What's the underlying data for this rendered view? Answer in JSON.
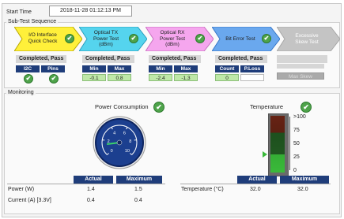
{
  "start_time": {
    "label": "Start Time",
    "value": "2018-11-28 01:12:13 PM"
  },
  "sub_test_sequence": {
    "title": "Sub-Test Sequence",
    "steps": [
      {
        "label": "I/O Interface\nQuick Check",
        "color": "#fff03a",
        "status": "Completed, Pass",
        "headers": [
          "I2C",
          "Pins"
        ]
      },
      {
        "label": "Optical TX\nPower Test\n(dBm)",
        "color": "#55d4ee",
        "status": "Completed, Pass",
        "headers": [
          "Min",
          "Max"
        ],
        "values": [
          "-0.1",
          "0.8"
        ]
      },
      {
        "label": "Optical RX\nPower Test\n(dBm)",
        "color": "#f5a6ee",
        "status": "Completed, Pass",
        "headers": [
          "Min",
          "Max"
        ],
        "values": [
          "-2.4",
          "-1.3"
        ]
      },
      {
        "label": "Bit Error Test",
        "color": "#6aa8ee",
        "status": "Completed, Pass",
        "headers": [
          "Count",
          "P.Loss"
        ],
        "values": [
          "0",
          ""
        ]
      },
      {
        "label": "Excessive\nSkew Test",
        "color": "#c4c4c4",
        "status": "",
        "headers": [
          "Max Skew"
        ]
      }
    ]
  },
  "monitoring": {
    "title": "Monitoring",
    "power": {
      "title": "Power Consumption",
      "gauge_ticks": [
        "0",
        "2",
        "4",
        "6",
        "8",
        "10"
      ],
      "gauge_value": 1.4,
      "col_headers": [
        "Actual",
        "Maximum"
      ],
      "rows": [
        {
          "label": "Power (W)",
          "actual": "1.4",
          "maximum": "1.5"
        },
        {
          "label": "Current (A) [3.3V]",
          "actual": "0.4",
          "maximum": "0.4"
        }
      ]
    },
    "temperature": {
      "title": "Temperature",
      "scale": [
        ">100",
        "75",
        "50",
        "25",
        "0"
      ],
      "level": 32.0,
      "col_headers": [
        "Actual",
        "Maximum"
      ],
      "rows": [
        {
          "label": "Temperature (°C)",
          "actual": "32.0",
          "maximum": "32.0"
        }
      ]
    }
  },
  "colors": {
    "header_blue": "#1f3d7a",
    "pass_green": "#4ea34a",
    "cell_green": "#bfe8a8",
    "gauge_blue": "#1c3f8f"
  }
}
